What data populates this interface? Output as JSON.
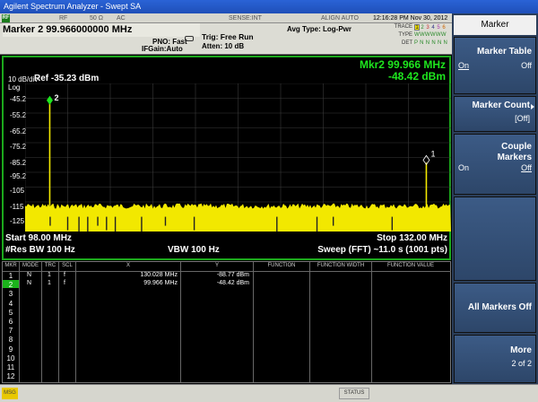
{
  "window": {
    "title": "Agilent Spectrum Analyzer - Swept SA"
  },
  "status": {
    "rf_icon": "RF",
    "rf": "RF",
    "impedance": "50 Ω",
    "coupling": "AC",
    "sense": "SENSE:INT",
    "align": "ALIGN AUTO",
    "datetime": "12:16:28 PM Nov 30, 2012"
  },
  "info": {
    "marker_title": "Marker 2  99.966000000 MHz",
    "pno": "PNO: Fast",
    "ifgain": "IFGain:Auto",
    "trig": "Trig: Free Run",
    "atten": "Atten: 10 dB",
    "avg_type": "Avg Type: Log-Pwr",
    "trace_label": "TRACE",
    "type_label": "TYPE",
    "det_label": "DET",
    "trace_boxes": [
      "1",
      "2",
      "3",
      "4",
      "5",
      "6"
    ],
    "type_row": "WWWWWW",
    "det_row": "P N N N N N"
  },
  "display": {
    "mkr_line1": "Mkr2 99.966 MHz",
    "mkr_line2": "-48.42 dBm",
    "scale": "10 dB/div",
    "scale_type": "Log",
    "ref": "Ref -35.23 dBm",
    "y_ticks": [
      "-45.2",
      "-55.2",
      "-65.2",
      "-75.2",
      "-85.2",
      "-95.2",
      "-105",
      "-115",
      "-125"
    ],
    "marker2_label": "2",
    "marker1_label": "1",
    "start": "Start 98.00 MHz",
    "stop": "Stop 132.00 MHz",
    "res_bw": "#Res BW 100 Hz",
    "vbw": "VBW 100 Hz",
    "sweep": "Sweep (FFT)  ~11.0 s (1001 pts)"
  },
  "chart_data": {
    "type": "line",
    "x_range_mhz": [
      98.0,
      132.0
    ],
    "y_range_dbm": [
      -135.23,
      -35.23
    ],
    "noise_floor_dbm": -118,
    "peaks": [
      {
        "x": 99.966,
        "y": -48.42
      },
      {
        "x": 130.028,
        "y": -88.77
      }
    ]
  },
  "table": {
    "headers": [
      "MKR",
      "MODE",
      "TRC",
      "SCL",
      "X",
      "Y",
      "FUNCTION",
      "FUNCTION WIDTH",
      "FUNCTION VALUE"
    ],
    "rows": [
      {
        "num": "1",
        "mode": "N",
        "trc": "1",
        "scl": "f",
        "x": "130.028 MHz",
        "y": "-88.77 dBm"
      },
      {
        "num": "2",
        "mode": "N",
        "trc": "1",
        "scl": "f",
        "x": "99.966 MHz",
        "y": "-48.42 dBm"
      }
    ],
    "row_numbers": [
      "1",
      "2",
      "3",
      "4",
      "5",
      "6",
      "7",
      "8",
      "9",
      "10",
      "11",
      "12"
    ]
  },
  "bottom": {
    "msg": "MSG",
    "status": "STATUS"
  },
  "softkeys": {
    "title": "Marker",
    "marker_table": {
      "label": "Marker Table",
      "on": "On",
      "off": "Off"
    },
    "marker_count": {
      "label": "Marker Count",
      "value": "[Off]"
    },
    "couple_markers": {
      "label1": "Couple",
      "label2": "Markers",
      "on": "On",
      "off": "Off"
    },
    "all_markers_off": {
      "label": "All Markers Off"
    },
    "more": {
      "label": "More",
      "page": "2 of 2"
    }
  }
}
